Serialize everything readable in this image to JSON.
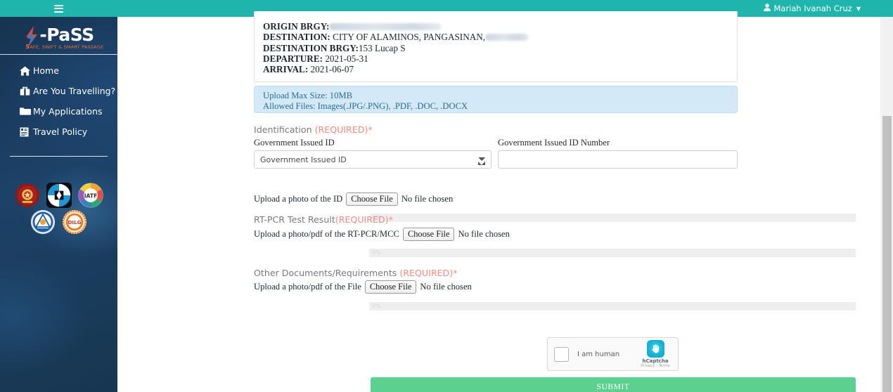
{
  "sidebar": {
    "hamburger_icon": "hamburger-icon",
    "brand": {
      "name": "-PaSS",
      "tagline_prefix": "S",
      "tagline": "AFE, SWIFT & SMART PASSAGE",
      "tagline_full": "SAFE, SWIFT & SMART PASSAGE"
    },
    "items": [
      {
        "label": "Home",
        "icon": "home-icon"
      },
      {
        "label": "Are You Travelling?",
        "icon": "suitcase-icon"
      },
      {
        "label": "My Applications",
        "icon": "folder-icon"
      },
      {
        "label": "Travel Policy",
        "icon": "document-icon"
      }
    ],
    "agency_logos": [
      {
        "name": "philippine-seal-logo"
      },
      {
        "name": "dict-logo"
      },
      {
        "name": "iatf-logo"
      },
      {
        "name": "ndrrmc-logo"
      },
      {
        "name": "dilg-logo"
      }
    ]
  },
  "topbar": {
    "user_name": "Mariah Ivanah Cruz",
    "user_icon": "user-icon",
    "caret_icon": "caret-down-icon"
  },
  "trip": {
    "origin_brgy_label": "ORIGIN BRGY:",
    "origin_brgy_value": "",
    "destination_label": "DESTINATION:",
    "destination_value": "CITY OF ALAMINOS, PANGASINAN,",
    "destination_brgy_label": "DESTINATION BRGY:",
    "destination_brgy_value": "153 Lucap S",
    "departure_label": "DEPARTURE:",
    "departure_value": "2021-05-31",
    "arrival_label": "ARRIVAL:",
    "arrival_value": "2021-06-07"
  },
  "alert": {
    "line1": "Upload Max Size: 10MB",
    "line2": "Allowed Files: Images(.JPG/.PNG), .PDF, .DOC, .DOCX"
  },
  "identification": {
    "title": "Identification ",
    "required": "(REQUIRED)",
    "star": "*",
    "id_type_label": "Government Issued ID",
    "id_type_selected": "Government Issued ID",
    "id_number_label": "Government Issued ID Number",
    "id_number_value": "",
    "id_number_placeholder": "",
    "upload_prompt": "Upload a photo of the ID",
    "choose_file": "Choose File",
    "no_file": "No file chosen",
    "progress": "0%"
  },
  "rtpcr": {
    "title": "RT-PCR Test Result",
    "required": "(REQUIRED)",
    "star": "*",
    "upload_prompt": "Upload a photo/pdf of the RT-PCR/MCC",
    "choose_file": "Choose File",
    "no_file": "No file chosen",
    "progress": "0%"
  },
  "other_docs": {
    "title": "Other Documents/Requirements ",
    "required": "(REQUIRED)",
    "star": "*",
    "upload_prompt": "Upload a photo/pdf of the File",
    "choose_file": "Choose File",
    "no_file": "No file chosen",
    "progress": "0%"
  },
  "captcha": {
    "label": "I am human",
    "brand": "hCaptcha",
    "terms": "Privacy - Terms",
    "logo_icon": "hcaptcha-hand-icon"
  },
  "submit": {
    "label": "SUBMIT"
  },
  "colors": {
    "teal_header": "#1fb5ad",
    "sidebar_navy": "#1b3a5c",
    "required_red": "#f28b82",
    "submit_green": "#5cd08e",
    "alert_blue": "#d3e9f7"
  }
}
